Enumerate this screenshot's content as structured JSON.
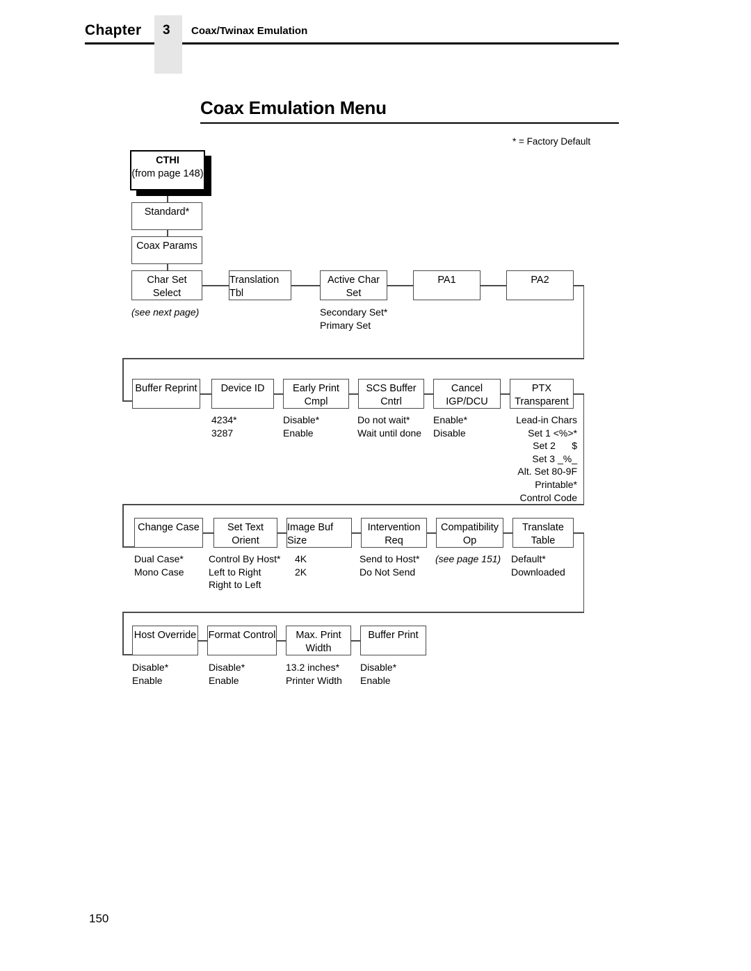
{
  "header": {
    "chapter_label": "Chapter",
    "chapter_number": "3",
    "subject": "Coax/Twinax Emulation"
  },
  "title": "Coax Emulation Menu",
  "legend": "* = Factory Default",
  "page_number": "150",
  "diagram": {
    "root": {
      "line1": "CTHI",
      "line2": "(from page 148)"
    },
    "chain": [
      {
        "line1": "Standard*",
        "line2": ""
      },
      {
        "line1": "Coax Params",
        "line2": ""
      }
    ],
    "row1": {
      "nodes": [
        {
          "line1": "Char Set",
          "line2": "Select"
        },
        {
          "line1": "Translation Tbl",
          "line2": ""
        },
        {
          "line1": "Active Char",
          "line2": "Set"
        },
        {
          "line1": "PA1",
          "line2": ""
        },
        {
          "line1": "PA2",
          "line2": ""
        }
      ],
      "options": {
        "char_set_select": "(see next page)",
        "active_char_set": "Secondary Set*\nPrimary Set"
      }
    },
    "row2": {
      "nodes": [
        {
          "line1": "Buffer Reprint",
          "line2": ""
        },
        {
          "line1": "Device ID",
          "line2": ""
        },
        {
          "line1": "Early Print",
          "line2": "Cmpl"
        },
        {
          "line1": "SCS Buffer",
          "line2": "Cntrl"
        },
        {
          "line1": "Cancel",
          "line2": "IGP/DCU"
        },
        {
          "line1": "PTX",
          "line2": "Transparent"
        }
      ],
      "options": {
        "device_id": "4234*\n3287",
        "early_print_cmpl": "Disable*\nEnable",
        "scs_buffer_cntrl": "Do not wait*\nWait until done",
        "cancel_igp_dcu": "Enable*\nDisable",
        "ptx_transparent": "Lead-in Chars\nSet 1 <%>*\nSet 2      $\nSet 3 _%_\nAlt. Set 80-9F\nPrintable*\nControl Code"
      }
    },
    "row3": {
      "nodes": [
        {
          "line1": "Change Case",
          "line2": ""
        },
        {
          "line1": "Set Text",
          "line2": "Orient"
        },
        {
          "line1": "Image Buf Size",
          "line2": ""
        },
        {
          "line1": "Intervention",
          "line2": "Req"
        },
        {
          "line1": "Compatibility",
          "line2": "Op"
        },
        {
          "line1": "Translate",
          "line2": "Table"
        }
      ],
      "options": {
        "change_case": "Dual Case*\nMono Case",
        "set_text_orient": "Control By Host*\nLeft to Right\nRight to Left",
        "image_buf_size": "4K\n2K",
        "intervention_req": "Send to Host*\nDo Not Send",
        "compatibility_op": "(see page 151)",
        "translate_table": "Default*\nDownloaded"
      }
    },
    "row4": {
      "nodes": [
        {
          "line1": "Host Override",
          "line2": ""
        },
        {
          "line1": "Format Control",
          "line2": ""
        },
        {
          "line1": "Max. Print",
          "line2": "Width"
        },
        {
          "line1": "Buffer Print",
          "line2": ""
        }
      ],
      "options": {
        "host_override": "Disable*\nEnable",
        "format_control": "Disable*\nEnable",
        "max_print_width": "13.2 inches*\nPrinter Width",
        "buffer_print": "Disable*\nEnable"
      }
    }
  }
}
